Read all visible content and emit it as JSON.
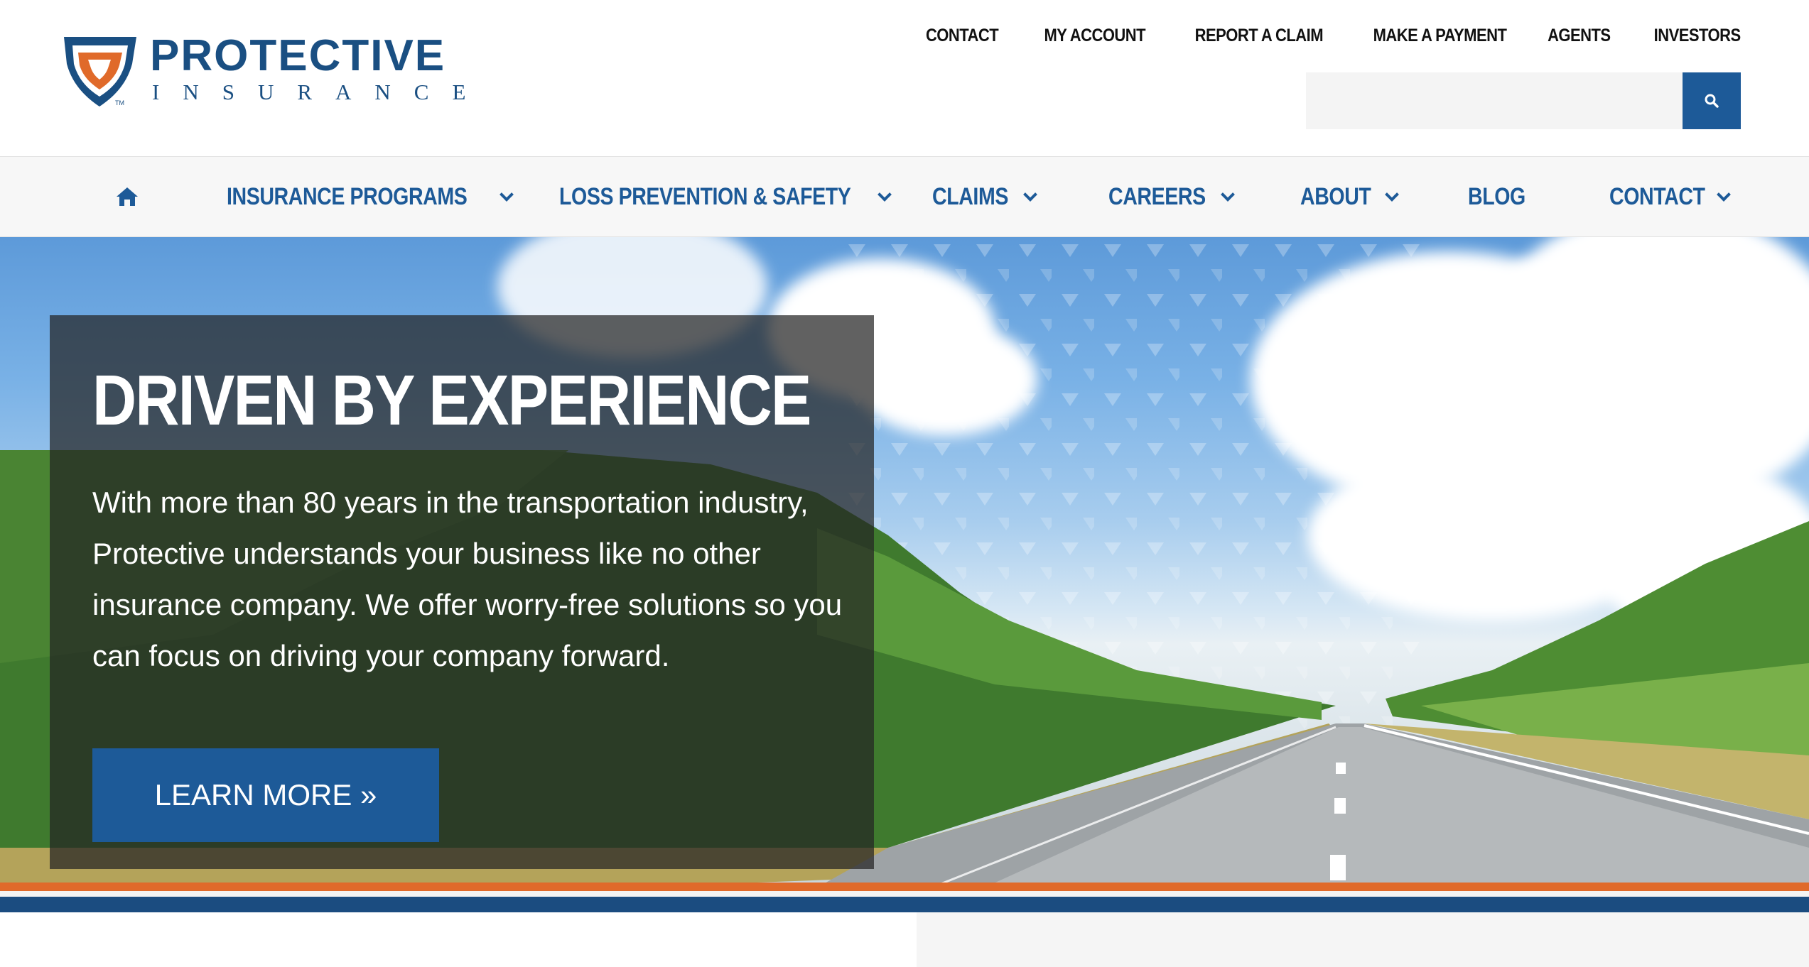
{
  "brand": {
    "name": "PROTECTIVE",
    "tagline": "INSURANCE",
    "trademark": "TM",
    "colors": {
      "primary": "#1d5a98",
      "accent": "#e06a2a",
      "dark_blue": "#1b4c80"
    }
  },
  "utility_nav": [
    {
      "label": "CONTACT"
    },
    {
      "label": "MY ACCOUNT"
    },
    {
      "label": "REPORT A CLAIM"
    },
    {
      "label": "MAKE A PAYMENT"
    },
    {
      "label": "AGENTS"
    },
    {
      "label": "INVESTORS"
    }
  ],
  "search": {
    "placeholder": "",
    "value": "",
    "icon": "search-icon"
  },
  "main_nav": {
    "home_icon": "home-icon",
    "items": [
      {
        "label": "INSURANCE PROGRAMS",
        "has_dropdown": true
      },
      {
        "label": "LOSS PREVENTION & SAFETY",
        "has_dropdown": true
      },
      {
        "label": "CLAIMS",
        "has_dropdown": true
      },
      {
        "label": "CAREERS",
        "has_dropdown": true
      },
      {
        "label": "ABOUT",
        "has_dropdown": true
      },
      {
        "label": "BLOG",
        "has_dropdown": false
      },
      {
        "label": "CONTACT",
        "has_dropdown": true
      }
    ]
  },
  "hero": {
    "title": "DRIVEN BY EXPERIENCE",
    "body": "With more than 80 years in the transportation industry, Protective understands your business like no other insurance company. We offer worry-free solutions so you can focus on driving your company forward.",
    "cta_label": "LEARN MORE »"
  }
}
